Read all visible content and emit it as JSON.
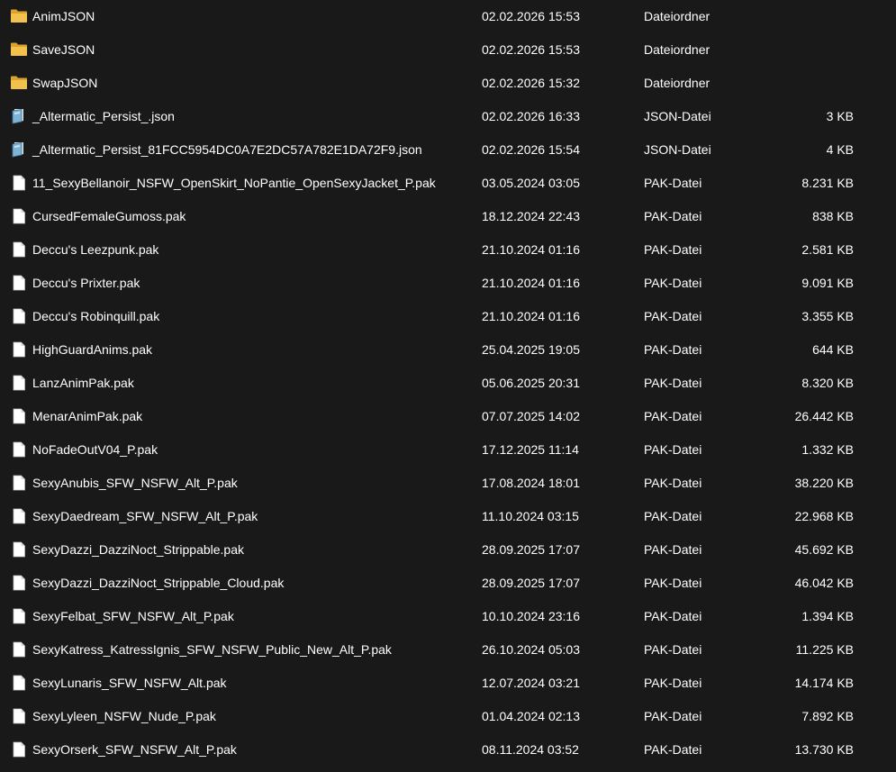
{
  "colors": {
    "background": "#191919",
    "text": "#ffffff",
    "folder": "#f2c14e",
    "json_icon": "#7fb3d5",
    "file_icon": "#ffffff"
  },
  "files": [
    {
      "name": "AnimJSON",
      "date": "02.02.2026 15:53",
      "type": "Dateiordner",
      "size": "",
      "icon": "folder-icon"
    },
    {
      "name": "SaveJSON",
      "date": "02.02.2026 15:53",
      "type": "Dateiordner",
      "size": "",
      "icon": "folder-icon"
    },
    {
      "name": "SwapJSON",
      "date": "02.02.2026 15:32",
      "type": "Dateiordner",
      "size": "",
      "icon": "folder-icon"
    },
    {
      "name": "_Altermatic_Persist_.json",
      "date": "02.02.2026 16:33",
      "type": "JSON-Datei",
      "size": "3 KB",
      "icon": "json-file-icon"
    },
    {
      "name": "_Altermatic_Persist_81FCC5954DC0A7E2DC57A782E1DA72F9.json",
      "date": "02.02.2026 15:54",
      "type": "JSON-Datei",
      "size": "4 KB",
      "icon": "json-file-icon"
    },
    {
      "name": "11_SexyBellanoir_NSFW_OpenSkirt_NoPantie_OpenSexyJacket_P.pak",
      "date": "03.05.2024 03:05",
      "type": "PAK-Datei",
      "size": "8.231 KB",
      "icon": "file-icon"
    },
    {
      "name": "CursedFemaleGumoss.pak",
      "date": "18.12.2024 22:43",
      "type": "PAK-Datei",
      "size": "838 KB",
      "icon": "file-icon"
    },
    {
      "name": "Deccu's Leezpunk.pak",
      "date": "21.10.2024 01:16",
      "type": "PAK-Datei",
      "size": "2.581 KB",
      "icon": "file-icon"
    },
    {
      "name": "Deccu's Prixter.pak",
      "date": "21.10.2024 01:16",
      "type": "PAK-Datei",
      "size": "9.091 KB",
      "icon": "file-icon"
    },
    {
      "name": "Deccu's Robinquill.pak",
      "date": "21.10.2024 01:16",
      "type": "PAK-Datei",
      "size": "3.355 KB",
      "icon": "file-icon"
    },
    {
      "name": "HighGuardAnims.pak",
      "date": "25.04.2025 19:05",
      "type": "PAK-Datei",
      "size": "644 KB",
      "icon": "file-icon"
    },
    {
      "name": "LanzAnimPak.pak",
      "date": "05.06.2025 20:31",
      "type": "PAK-Datei",
      "size": "8.320 KB",
      "icon": "file-icon"
    },
    {
      "name": "MenarAnimPak.pak",
      "date": "07.07.2025 14:02",
      "type": "PAK-Datei",
      "size": "26.442 KB",
      "icon": "file-icon"
    },
    {
      "name": "NoFadeOutV04_P.pak",
      "date": "17.12.2025 11:14",
      "type": "PAK-Datei",
      "size": "1.332 KB",
      "icon": "file-icon"
    },
    {
      "name": "SexyAnubis_SFW_NSFW_Alt_P.pak",
      "date": "17.08.2024 18:01",
      "type": "PAK-Datei",
      "size": "38.220 KB",
      "icon": "file-icon"
    },
    {
      "name": "SexyDaedream_SFW_NSFW_Alt_P.pak",
      "date": "11.10.2024 03:15",
      "type": "PAK-Datei",
      "size": "22.968 KB",
      "icon": "file-icon"
    },
    {
      "name": "SexyDazzi_DazziNoct_Strippable.pak",
      "date": "28.09.2025 17:07",
      "type": "PAK-Datei",
      "size": "45.692 KB",
      "icon": "file-icon"
    },
    {
      "name": "SexyDazzi_DazziNoct_Strippable_Cloud.pak",
      "date": "28.09.2025 17:07",
      "type": "PAK-Datei",
      "size": "46.042 KB",
      "icon": "file-icon"
    },
    {
      "name": "SexyFelbat_SFW_NSFW_Alt_P.pak",
      "date": "10.10.2024 23:16",
      "type": "PAK-Datei",
      "size": "1.394 KB",
      "icon": "file-icon"
    },
    {
      "name": "SexyKatress_KatressIgnis_SFW_NSFW_Public_New_Alt_P.pak",
      "date": "26.10.2024 05:03",
      "type": "PAK-Datei",
      "size": "11.225 KB",
      "icon": "file-icon"
    },
    {
      "name": "SexyLunaris_SFW_NSFW_Alt.pak",
      "date": "12.07.2024 03:21",
      "type": "PAK-Datei",
      "size": "14.174 KB",
      "icon": "file-icon"
    },
    {
      "name": "SexyLyleen_NSFW_Nude_P.pak",
      "date": "01.04.2024 02:13",
      "type": "PAK-Datei",
      "size": "7.892 KB",
      "icon": "file-icon"
    },
    {
      "name": "SexyOrserk_SFW_NSFW_Alt_P.pak",
      "date": "08.11.2024 03:52",
      "type": "PAK-Datei",
      "size": "13.730 KB",
      "icon": "file-icon"
    }
  ]
}
